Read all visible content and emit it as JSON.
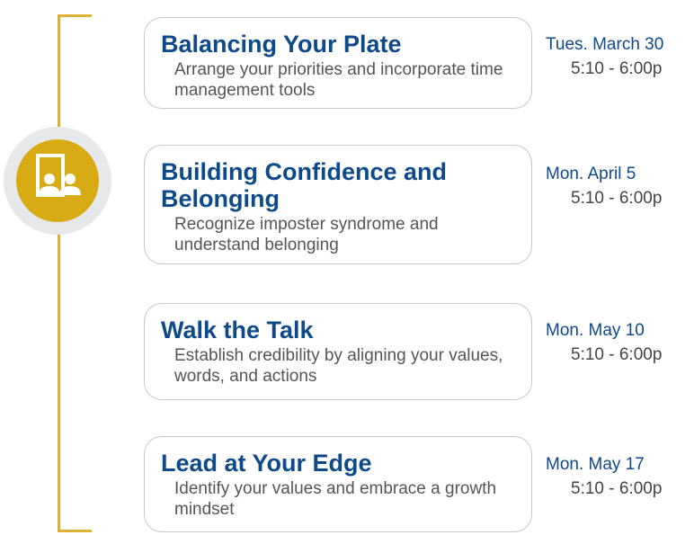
{
  "sessions": [
    {
      "title": "Balancing Your Plate",
      "description": "Arrange your priorities and incorporate time management tools",
      "date": "Tues. March 30",
      "time": "5:10 - 6:00p"
    },
    {
      "title": "Building Confidence and Belonging",
      "description": "Recognize imposter syndrome and understand belonging",
      "date": "Mon. April 5",
      "time": "5:10 - 6:00p"
    },
    {
      "title": "Walk the Talk",
      "description": "Establish credibility by aligning your values, words, and actions",
      "date": "Mon. May 10",
      "time": "5:10 - 6:00p"
    },
    {
      "title": "Lead at Your Edge",
      "description": "Identify your values and embrace a growth mindset",
      "date": "Mon. May 17",
      "time": "5:10 - 6:00p"
    }
  ],
  "icon": "two-people-icon",
  "colors": {
    "accent_gold": "#d8ab14",
    "title_blue": "#0e4a8a",
    "bracket": "#d9b233"
  }
}
